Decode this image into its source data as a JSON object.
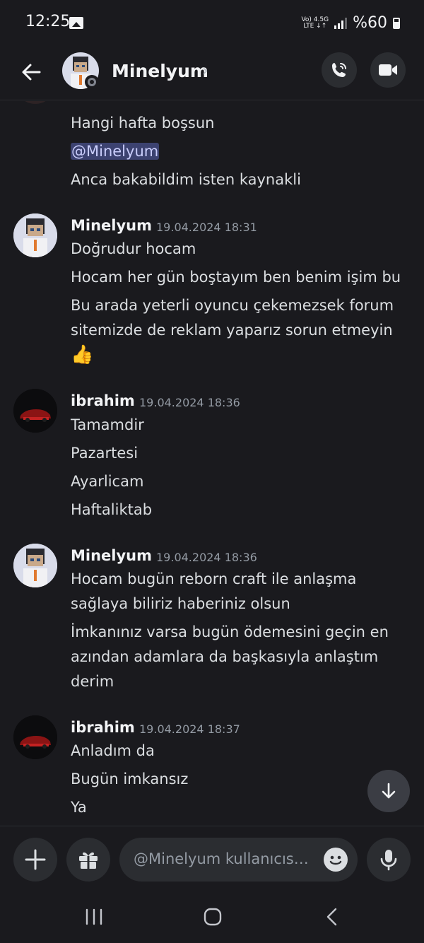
{
  "status_bar": {
    "time": "12:25",
    "network_top": "Vo) 4.5G",
    "network_bottom": "LTE ↓↑",
    "battery": "%60"
  },
  "header": {
    "title": "Minelyum",
    "chevron": "›"
  },
  "messages": {
    "continuation": {
      "line1": "Hangi hafta boşsun",
      "mention": "@Minelyum",
      "line3": "Anca bakabildim isten kaynakli"
    },
    "group1": {
      "author": "Minelyum",
      "time": "19.04.2024 18:31",
      "lines": [
        "Doğrudur hocam",
        "Hocam her gün boştayım ben benim işim bu",
        "Bu arada yeterli oyuncu çekemezsek forum",
        "sitemizde de reklam yaparız sorun etmeyin",
        "👍"
      ]
    },
    "group2": {
      "author": "ibrahim",
      "time": "19.04.2024 18:36",
      "lines": [
        "Tamamdir",
        "Pazartesi",
        "Ayarlicam",
        "Haftaliktab"
      ]
    },
    "group3": {
      "author": "Minelyum",
      "time": "19.04.2024 18:36",
      "lines": [
        "Hocam bugün reborn craft ile anlaşma",
        "sağlaya biliriz haberiniz olsun",
        "İmkanınız varsa bugün ödemesini geçin en",
        "azından adamlara da başkasıyla anlaştım",
        "derim"
      ]
    },
    "group4": {
      "author": "ibrahim",
      "time": "19.04.2024 18:37",
      "lines": [
        "Anladım da",
        "Bugün imkansız",
        "Ya"
      ]
    }
  },
  "composer": {
    "placeholder": "@Minelyum kullanıcısına mesaj gönder"
  },
  "colors": {
    "background": "#1a1a1e",
    "surface": "#2b2d31",
    "mention_bg": "#3c4270",
    "mention_text": "#c9cdfb",
    "muted": "#949ba4"
  }
}
